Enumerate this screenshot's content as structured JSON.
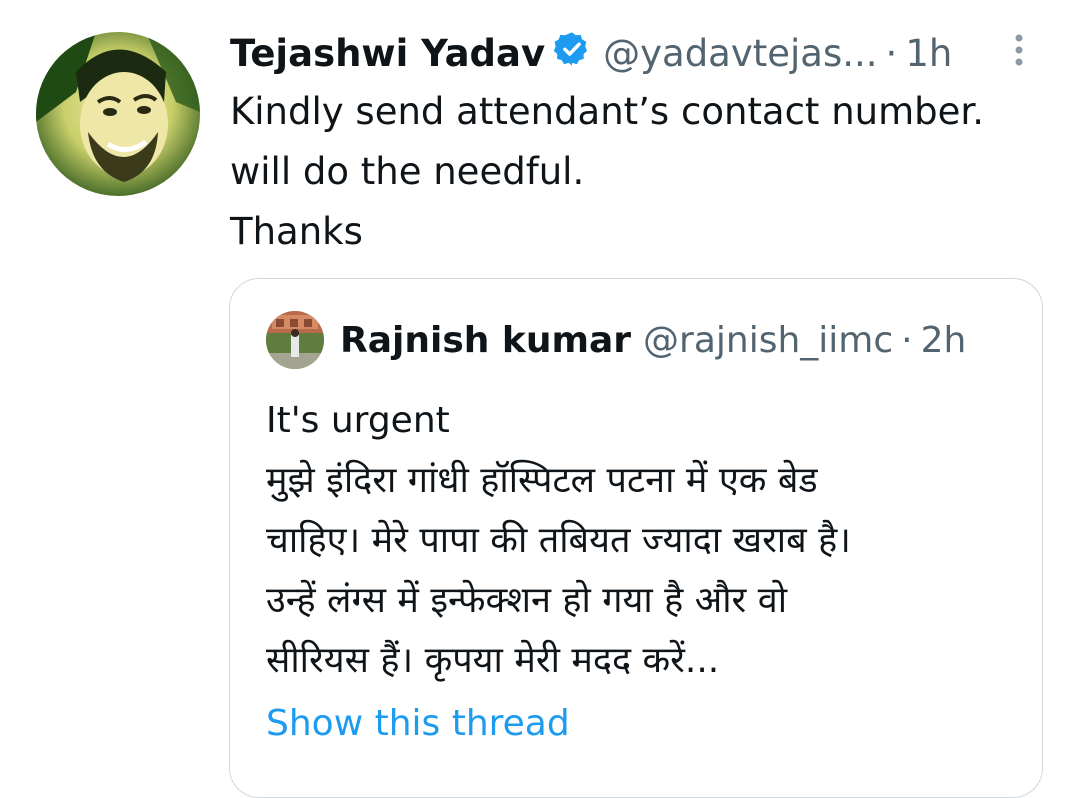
{
  "tweet": {
    "author_name": "Tejashwi Yadav",
    "author_handle": "@yadavtejas...",
    "separator": "·",
    "time": "1h",
    "text_lines": [
      "Kindly send attendant’s contact number.",
      "will do the needful.",
      "Thanks"
    ],
    "icons": {
      "verified": "verified-badge-icon",
      "more": "more-options-icon"
    }
  },
  "quoted_tweet": {
    "author_name": "Rajnish kumar",
    "author_handle": "@rajnish_iimc",
    "separator": "·",
    "time": "2h",
    "text_lines": [
      "It's urgent",
      "मुझे इंदिरा गांधी हॉस्पिटल पटना में एक बेड",
      "चाहिए। मेरे पापा की तबियत ज्यादा खराब है।",
      "उन्हें लंग्स में इन्फेक्शन हो गया है और वो",
      "सीरियस हैं। कृपया मेरी मदद करें..."
    ],
    "show_thread_label": "Show this thread"
  },
  "colors": {
    "text": "#0f1419",
    "secondary": "#536471",
    "link": "#1d9bf0",
    "border": "#cfd9de",
    "verified": "#1d9bf0"
  }
}
